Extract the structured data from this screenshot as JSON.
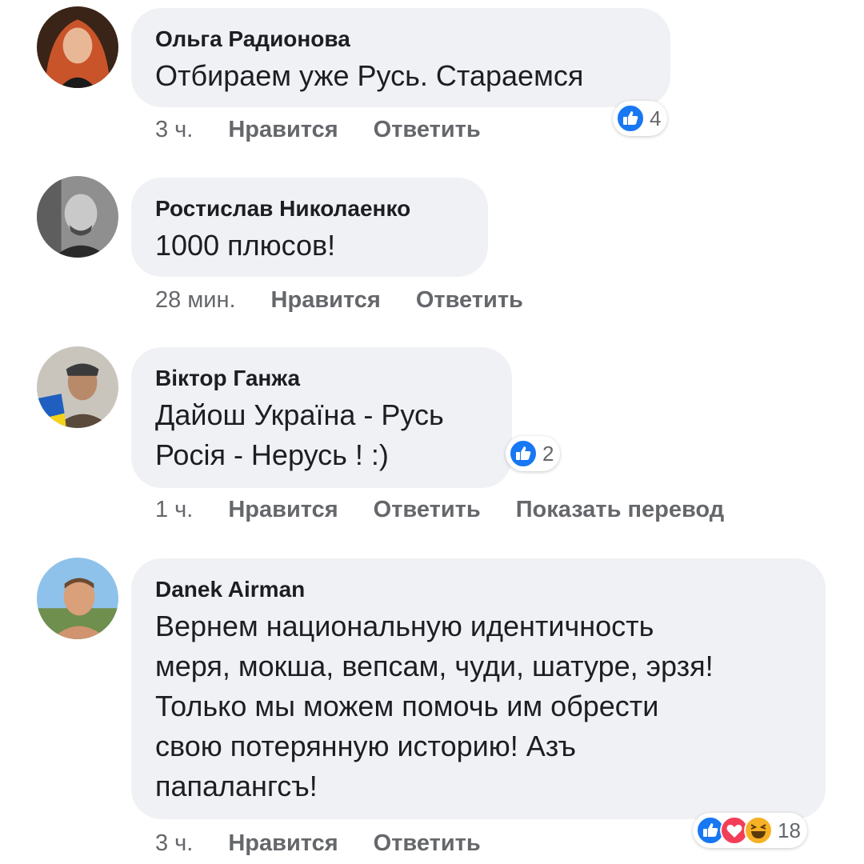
{
  "actions": {
    "like": "Нравится",
    "reply": "Ответить",
    "translate": "Показать перевод"
  },
  "colors": {
    "like_blue": "#1877f2",
    "love_red": "#f33e58",
    "haha_yellow": "#f7b125",
    "bubble_bg": "#f0f1f4",
    "meta_gray": "#65676b"
  },
  "comments": [
    {
      "author": "Ольга Радионова",
      "text": "Отбираем уже Русь. Стараемся",
      "time": "3 ч.",
      "reactions": {
        "icons": [
          "like-icon"
        ],
        "count": "4"
      }
    },
    {
      "author": "Ростислав Николаенко",
      "text": "1000 плюсов!",
      "time": "28 мин."
    },
    {
      "author": "Віктор Ганжа",
      "text": "Дайош Україна - Русь\nРосія - Нерусь ! :)",
      "time": "1 ч.",
      "reactions": {
        "icons": [
          "like-icon"
        ],
        "count": "2"
      }
    },
    {
      "author": "Danek Airman",
      "text": "Вернем национальную идентичность\nмеря, мокша, вепсам, чуди, шатуре, эрзя!\nТолько мы можем помочь им обрести\nсвою потерянную историю! Азъ\nпапалангсъ!",
      "time": "3 ч.",
      "reactions": {
        "icons": [
          "like-icon",
          "love-icon",
          "haha-icon"
        ],
        "count": "18"
      }
    }
  ]
}
